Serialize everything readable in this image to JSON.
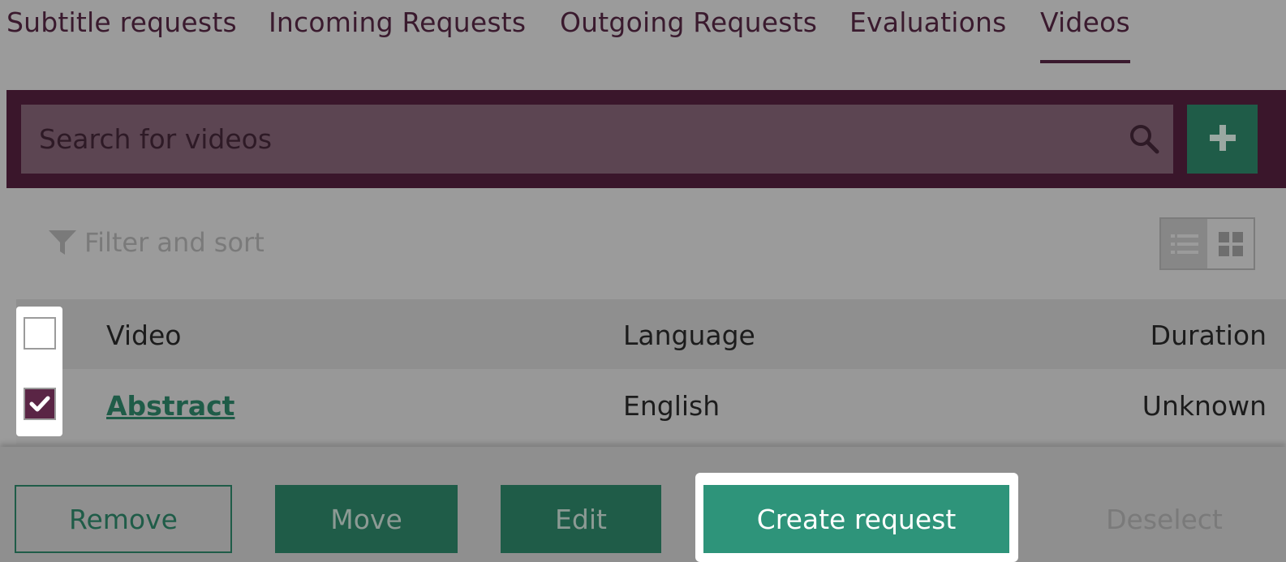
{
  "tabs": [
    {
      "label": "Subtitle requests",
      "active": false
    },
    {
      "label": "Incoming Requests",
      "active": false
    },
    {
      "label": "Outgoing Requests",
      "active": false
    },
    {
      "label": "Evaluations",
      "active": false
    },
    {
      "label": "Videos",
      "active": true
    }
  ],
  "search": {
    "placeholder": "Search for videos",
    "value": "",
    "icon": "search-icon",
    "add_icon": "plus-icon"
  },
  "filter": {
    "label": "Filter and sort",
    "icon": "filter-icon"
  },
  "view_toggle": {
    "options": [
      "list-view-icon",
      "grid-view-icon"
    ],
    "selected": "list-view-icon"
  },
  "table": {
    "headers": {
      "video": "Video",
      "language": "Language",
      "duration": "Duration"
    },
    "rows": [
      {
        "video": "Abstract",
        "language": "English",
        "duration": "Unknown",
        "checked": true
      }
    ]
  },
  "actions": {
    "remove": "Remove",
    "move": "Move",
    "edit": "Edit",
    "create_request": "Create request",
    "deselect": "Deselect"
  },
  "colors": {
    "brand_dark": "#3a162b",
    "accent_green": "#1f5c48",
    "primary_green": "#2e947a",
    "overlay_gray": "#9b9b9b"
  }
}
